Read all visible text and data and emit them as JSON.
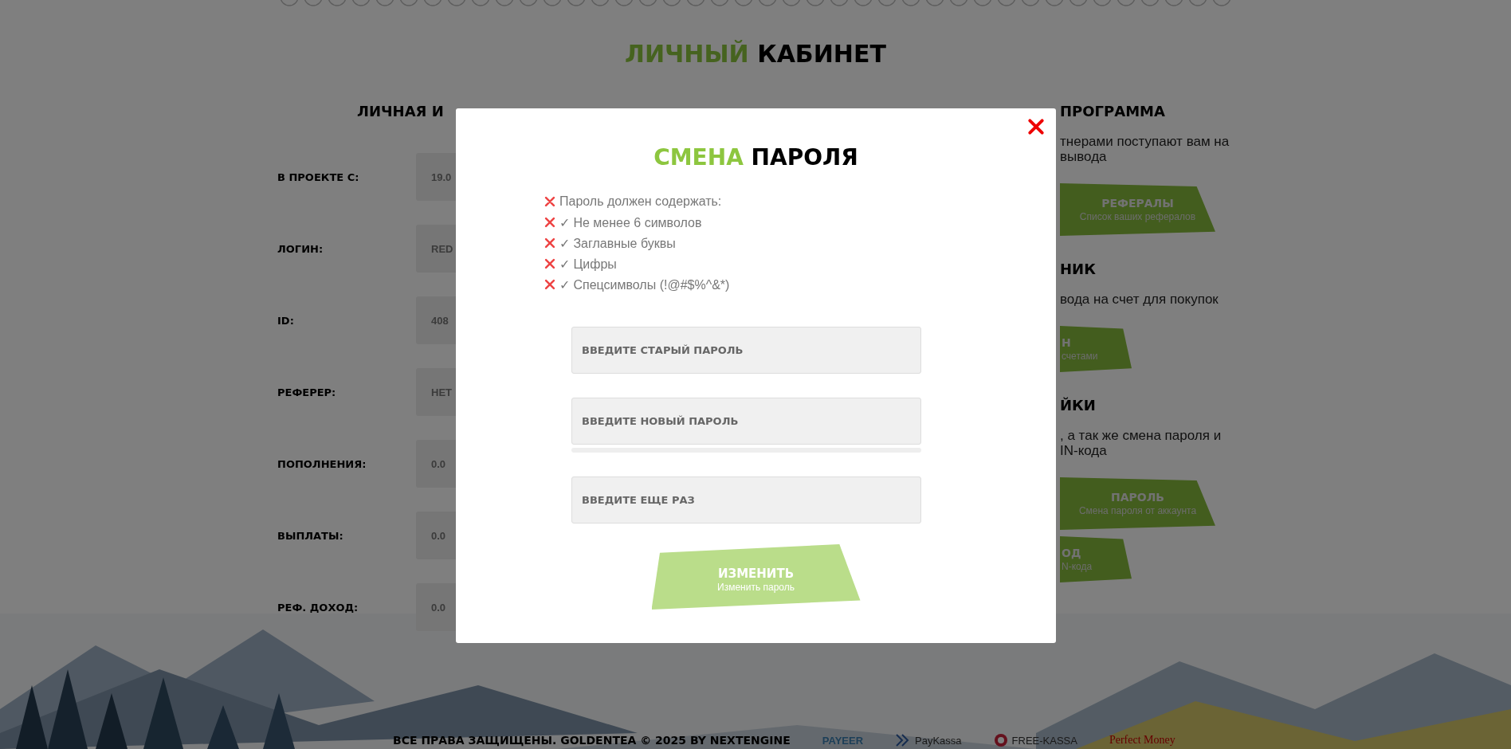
{
  "header": {
    "title_accent": "ЛИЧНЫЙ",
    "title_rest": "КАБИНЕТ"
  },
  "personal": {
    "title": "ЛИЧНАЯ И",
    "rows": [
      {
        "label": "В ПРОЕКТЕ С:",
        "value": "19.0"
      },
      {
        "label": "ЛОГИН:",
        "value": "RED"
      },
      {
        "label": "ID:",
        "value": "408"
      },
      {
        "label": "РЕФЕРЕР:",
        "value": "НЕТ"
      },
      {
        "label": "ПОПОЛНЕНИЯ:",
        "value": "0.0"
      },
      {
        "label": "ВЫПЛАТЫ:",
        "value": "0.0"
      },
      {
        "label": "РЕФ. ДОХОД:",
        "value": "0.0"
      }
    ]
  },
  "sections": [
    {
      "title": "ПРОГРАММА",
      "lines": [
        "тнерами поступают вам на",
        "вывода"
      ],
      "buttons": [
        {
          "title": "РЕФЕРАЛЫ",
          "subtitle": "Список ваших рефералов",
          "partial": false
        }
      ]
    },
    {
      "title": "НИК",
      "lines": [
        "вода на счет для покупок"
      ],
      "buttons": [
        {
          "title": "Н",
          "subtitle": "счетами",
          "partial": true
        }
      ]
    },
    {
      "title": "ЙКИ",
      "lines": [
        ", а так же смена пароля и",
        "IN-кода"
      ],
      "buttons": [
        {
          "title": "ПАРОЛЬ",
          "subtitle": "Смена пароля от аккаунта",
          "partial": false
        },
        {
          "title": "ОД",
          "subtitle": "N-кода",
          "partial": true
        }
      ]
    }
  ],
  "modal": {
    "title_accent": "СМЕНА",
    "title_rest": "ПАРОЛЯ",
    "requirements": [
      {
        "text": "Пароль должен содержать:",
        "met": false
      },
      {
        "text": "✓ Не менее 6 символов",
        "met": false
      },
      {
        "text": "✓ Заглавные буквы",
        "met": false
      },
      {
        "text": "✓ Цифры",
        "met": false
      },
      {
        "text": "✓ Спецсимволы (!@#$%^&*)",
        "met": false
      }
    ],
    "fields": [
      {
        "placeholder": "ВВЕДИТЕ СТАРЫЙ ПАРОЛЬ"
      },
      {
        "placeholder": "ВВЕДИТЕ НОВЫЙ ПАРОЛЬ",
        "strength": {
          "level": 0
        }
      },
      {
        "placeholder": "ВВЕДИТЕ ЕЩЕ РАЗ"
      }
    ],
    "submit": {
      "title": "ИЗМЕНИТЬ",
      "subtitle": "Изменить пароль"
    }
  },
  "footer": {
    "copyright": "ВСЕ ПРАВА ЗАЩИЩЕНЫ. GOLDENTEA © 2025 BY NEXTENGINE",
    "payments": [
      {
        "name": "PAYEER",
        "kind": "plain"
      },
      {
        "name": "PayKassa",
        "kind": "chevron"
      },
      {
        "name": "FREE-KASSA",
        "kind": "badge"
      },
      {
        "name": "Perfect Money",
        "kind": "serif"
      }
    ]
  }
}
